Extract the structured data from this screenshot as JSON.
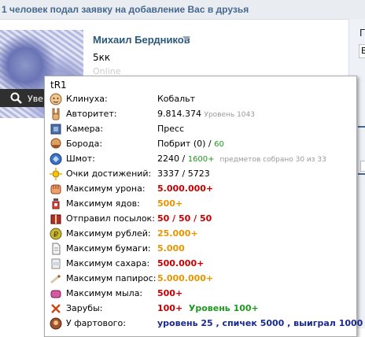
{
  "notice": {
    "text": "1 человек подал заявку на добавление Вас в друзья"
  },
  "profile": {
    "name": "Михаил Бердников",
    "status": "5кк",
    "online": "Online",
    "photo_button": "Уве"
  },
  "right_column": {
    "letter": "Г",
    "input_letter": "В"
  },
  "tooltip": {
    "title": "tR1",
    "rows": [
      {
        "icon": "face-icon",
        "label": "Клинуха:",
        "value": "Кобальт"
      },
      {
        "icon": "hand-horns-icon",
        "label": "Авторитет:",
        "value": "9.814.374",
        "extra": "Уровень 1043"
      },
      {
        "icon": "camera-icon",
        "label": "Камера:",
        "value": "Пресс"
      },
      {
        "icon": "beard-icon",
        "label": "Борода:",
        "value": "Побрит (0) /",
        "extra": "60"
      },
      {
        "icon": "shmot-icon",
        "label": "Шмот:",
        "value": "2240 /",
        "extra": "1600+",
        "extra2": "предметов собрано 30 из 33"
      },
      {
        "icon": "sun-badge-icon",
        "label": "Очки достижений:",
        "value": "3337 / 5723"
      },
      {
        "icon": "fist-icon",
        "label": "Максимум урона:",
        "value": "5.000.000+"
      },
      {
        "icon": "poison-icon",
        "label": "Максимум ядов:",
        "value": "500+"
      },
      {
        "icon": "parcel-icon",
        "label": "Отправил посылок:",
        "value": "50 / 50 / 50"
      },
      {
        "icon": "coin-icon",
        "label": "Максимум рублей:",
        "value": "25.000+"
      },
      {
        "icon": "paper-icon",
        "label": "Максимум бумаги:",
        "value": "5.000"
      },
      {
        "icon": "sugar-icon",
        "label": "Максимум сахара:",
        "value": "500.000+"
      },
      {
        "icon": "cigarette-icon",
        "label": "Максимум папирос:",
        "value": "5.000.000+"
      },
      {
        "icon": "soap-icon",
        "label": "Максимум мыла:",
        "value": "500+"
      },
      {
        "icon": "bones-icon",
        "label": "Зарубы:",
        "value": "100+",
        "extra": "Уровень 100+"
      },
      {
        "icon": "lucky-icon",
        "label": "У фартового:",
        "value": "уровень 25 , спичек 5000 , выиграл 1000"
      }
    ]
  },
  "colors": {
    "link": "#2b587a",
    "notice_bg": "#e9edf1",
    "red": "#c40000",
    "orange": "#e69500",
    "green": "#1e9a1e"
  }
}
